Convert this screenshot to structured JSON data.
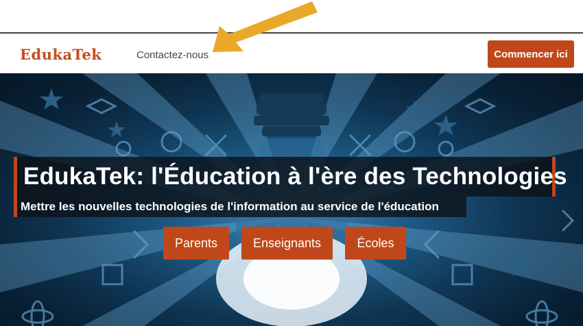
{
  "header": {
    "logo": "EdukaTek",
    "nav": {
      "contact": "Contactez-nous"
    },
    "cta": "Commencer ici"
  },
  "hero": {
    "title": "EdukaTek: l'Éducation à l'ère des Technologies",
    "subtitle": "Mettre les nouvelles technologies de l'information au service de l'éducation",
    "buttons": {
      "parents": "Parents",
      "teachers": "Enseignants",
      "schools": "Écoles"
    }
  },
  "colors": {
    "brand": "#c44d1c",
    "button": "#c0471a",
    "hero_dark": "#0f3553",
    "annotation_arrow": "#e8a92a"
  },
  "annotation": {
    "icon": "arrow-pointer-icon"
  }
}
